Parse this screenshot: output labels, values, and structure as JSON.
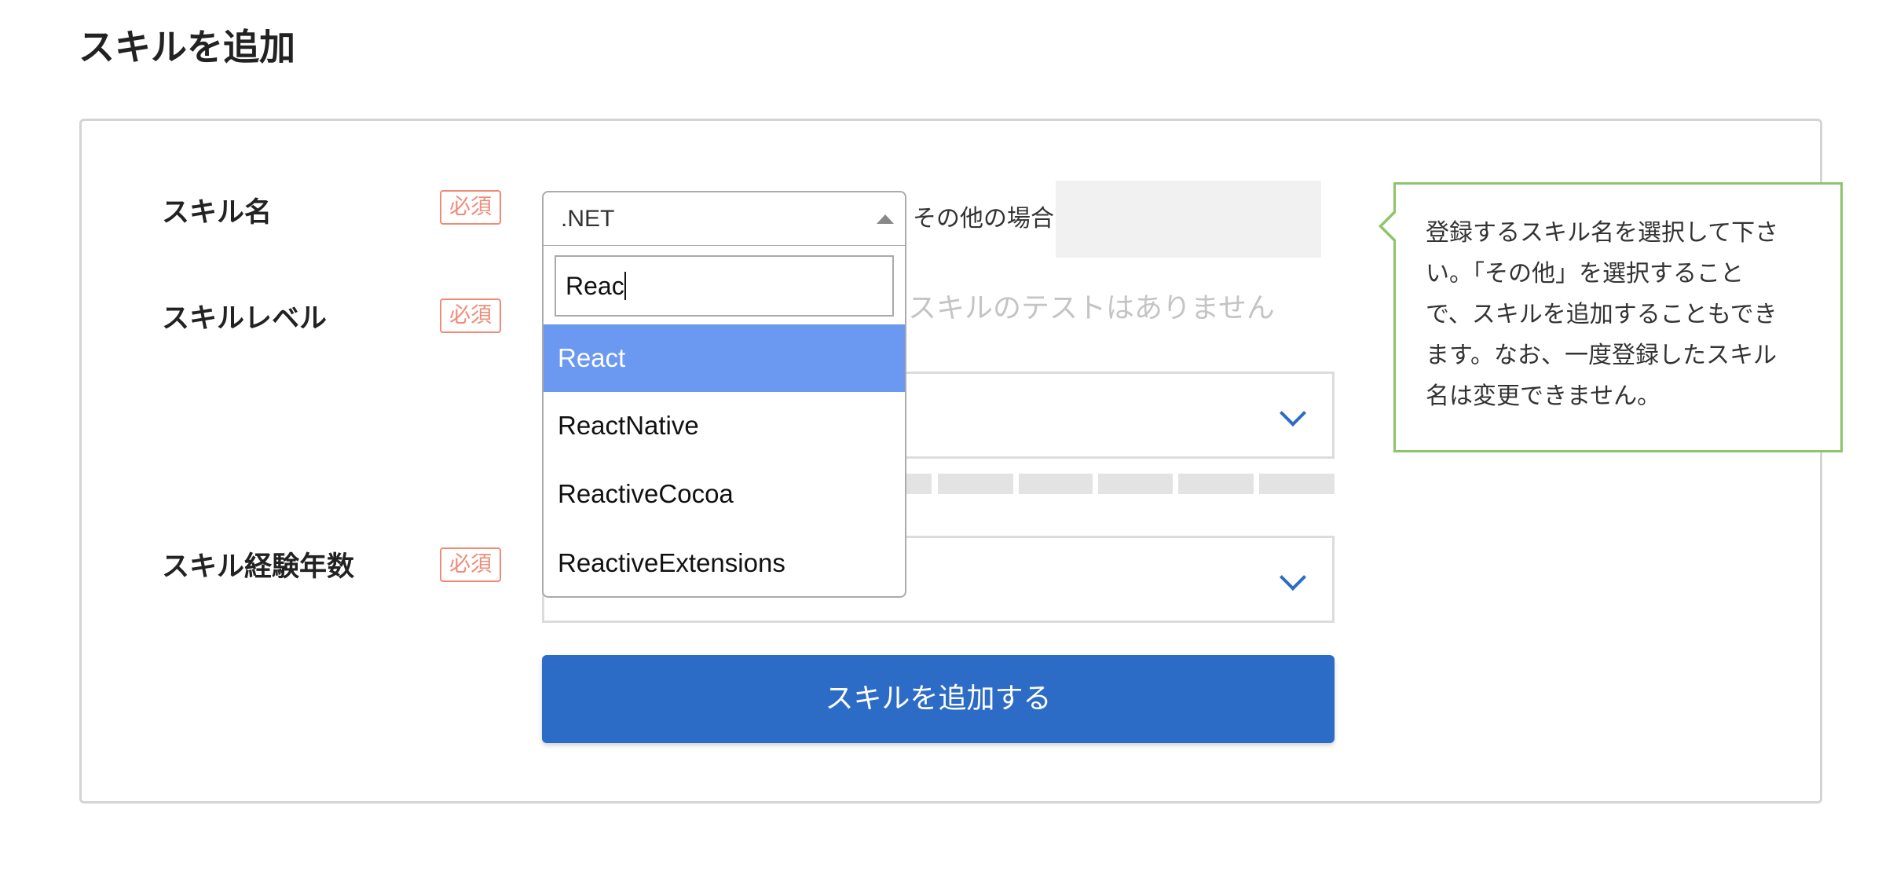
{
  "page": {
    "title": "スキルを追加"
  },
  "form": {
    "required_badge": "必須",
    "skill_name": {
      "label": "スキル名",
      "selected_value": ".NET",
      "other_label": "その他の場合",
      "other_value": ""
    },
    "skill_level": {
      "label": "スキルレベル",
      "no_test_message": "スキルのテストはありません",
      "selected_value": ""
    },
    "skill_years": {
      "label": "スキル経験年数",
      "selected_value": ""
    },
    "submit_label": "スキルを追加する"
  },
  "dropdown": {
    "search_value": "Reac",
    "options": [
      {
        "label": "React",
        "highlighted": true
      },
      {
        "label": "ReactNative",
        "highlighted": false
      },
      {
        "label": "ReactiveCocoa",
        "highlighted": false
      },
      {
        "label": "ReactiveExtensions",
        "highlighted": false
      }
    ]
  },
  "tooltip": {
    "lines": [
      "登録するスキル名を選択して下さ",
      "い。「その他」を選択すること",
      "で、スキルを追加することもでき",
      "ます。なお、一度登録したスキル",
      "名は変更できません。"
    ]
  },
  "colors": {
    "primary": "#2d6cc6",
    "required": "#f08a78",
    "highlight": "#6b98f0",
    "tooltip_border": "#8ec46a"
  }
}
